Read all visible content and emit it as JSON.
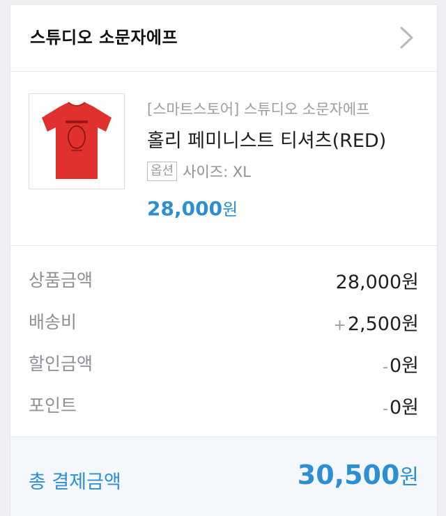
{
  "store": {
    "name": "스튜디오 소문자에프"
  },
  "product": {
    "store_tag": "[스마트스토어] 스튜디오 소문자에프",
    "name": "홀리 페미니스트 티셔츠(RED)",
    "option_badge": "옵션",
    "option_text": "사이즈: XL",
    "price": "28,000",
    "price_unit": "원",
    "thumbnail_icon": "red-tshirt-image"
  },
  "summary": {
    "rows": [
      {
        "label": "상품금액",
        "sign": "",
        "value": "28,000원"
      },
      {
        "label": "배송비",
        "sign": "+",
        "value": "2,500원"
      },
      {
        "label": "할인금액",
        "sign": "-",
        "value": "0원"
      },
      {
        "label": "포인트",
        "sign": "-",
        "value": "0원"
      }
    ]
  },
  "total": {
    "label": "총 결제금액",
    "value": "30,500",
    "unit": "원"
  },
  "colors": {
    "accent": "#2c8fd3",
    "muted": "#8d9097",
    "shirt": "#e0312f"
  }
}
